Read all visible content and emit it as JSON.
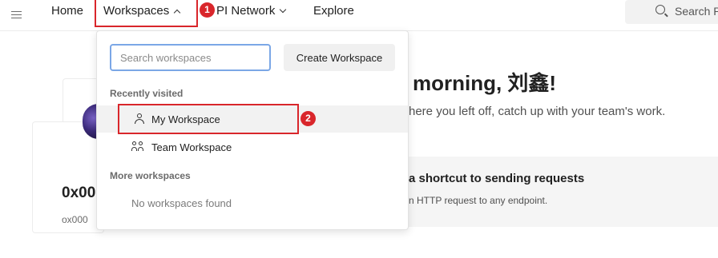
{
  "nav": {
    "home": "Home",
    "workspaces": "Workspaces",
    "api_network": "PI Network",
    "explore": "Explore",
    "search_placeholder": "Search P"
  },
  "annotations": {
    "step1": "1",
    "step2": "2",
    "color": "#d9262b"
  },
  "background": {
    "greeting": "morning, 刘鑫!",
    "subgreeting": "here you left off, catch up with your team's work.",
    "shortcut_title": "a shortcut to sending requests",
    "shortcut_desc": "n HTTP request to any endpoint.",
    "profile_id": "0x00",
    "profile_sub": "ox000"
  },
  "dropdown": {
    "search_placeholder": "Search workspaces",
    "create_label": "Create Workspace",
    "recent_heading": "Recently visited",
    "recent_items": [
      {
        "label": "My Workspace",
        "icon": "person-icon"
      },
      {
        "label": "Team Workspace",
        "icon": "team-icon"
      }
    ],
    "more_heading": "More workspaces",
    "empty_text": "No workspaces found"
  }
}
